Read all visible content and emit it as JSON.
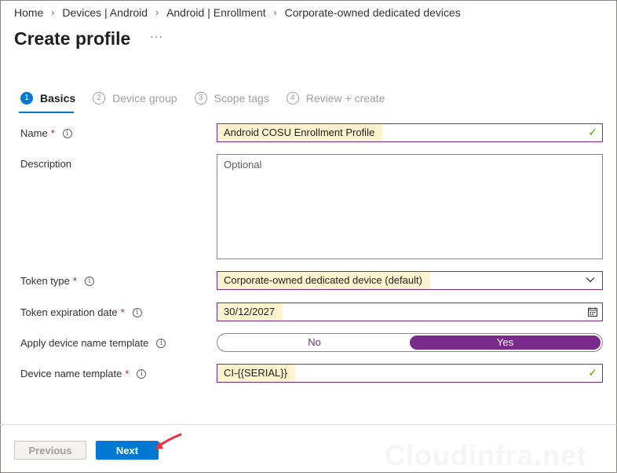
{
  "breadcrumb": {
    "items": [
      "Home",
      "Devices | Android",
      "Android | Enrollment",
      "Corporate-owned dedicated devices"
    ]
  },
  "page": {
    "title": "Create profile",
    "more": "···"
  },
  "steps": [
    {
      "num": "1",
      "label": "Basics"
    },
    {
      "num": "2",
      "label": "Device group"
    },
    {
      "num": "3",
      "label": "Scope tags"
    },
    {
      "num": "4",
      "label": "Review + create"
    }
  ],
  "form": {
    "name": {
      "label": "Name",
      "required": "*",
      "value": "Android COSU Enrollment Profile"
    },
    "description": {
      "label": "Description",
      "placeholder": "Optional"
    },
    "token_type": {
      "label": "Token type",
      "required": "*",
      "value": "Corporate-owned dedicated device (default)"
    },
    "token_expiration": {
      "label": "Token expiration date",
      "required": "*",
      "value": "30/12/2027"
    },
    "apply_template": {
      "label": "Apply device name template",
      "no": "No",
      "yes": "Yes",
      "selected": "Yes"
    },
    "name_template": {
      "label": "Device name template",
      "required": "*",
      "value": "CI-{{SERIAL}}"
    }
  },
  "footer": {
    "previous": "Previous",
    "next": "Next"
  },
  "watermark": "Cloudinfra.net",
  "colors": {
    "accent": "#0078d4",
    "field_border": "#7a2a8a",
    "highlight": "#fff4ce",
    "required": "#a4262c",
    "annotation_arrow": "#e8323c"
  }
}
